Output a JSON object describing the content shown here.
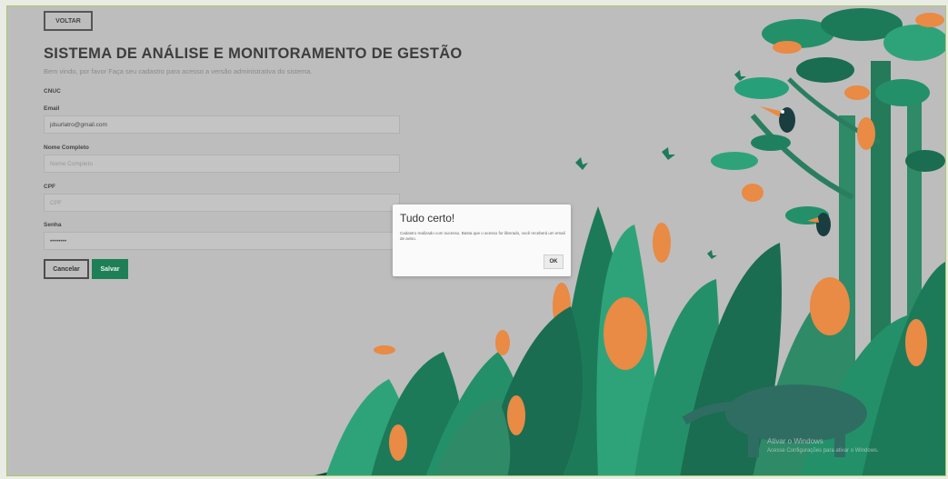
{
  "page": {
    "back_button": "VOLTAR",
    "title": "SISTEMA DE ANÁLISE E MONITORAMENTO DE GESTÃO",
    "subtitle": "Bem vindo, por favor Faça seu cadastro para acesso a versão administrativa do sistema."
  },
  "form": {
    "cnuc_label": "CNUC",
    "email_label": "Email",
    "email_value": "jdsurlatro@gmail.com",
    "name_label": "Nome Completo",
    "name_placeholder": "Nome Completo",
    "cpf_label": "CPF",
    "cpf_placeholder": "CPF",
    "password_label": "Senha",
    "password_value": "••••••••",
    "cancel_label": "Cancelar",
    "save_label": "Salvar"
  },
  "dialog": {
    "title": "Tudo certo!",
    "message": "Cadastro realizado com sucesso. Basta que o acesso for liberado, você receberá um email de aviso.",
    "ok_label": "OK"
  },
  "watermark": {
    "line1": "Ativar o Windows",
    "line2": "Acesse Configurações para ativar o Windows."
  },
  "colors": {
    "background": "#bdbdbd",
    "accent": "#1e7f57",
    "frame_border": "#aac86b"
  },
  "icons": [
    "jungle-illustration",
    "toucan-icon",
    "butterfly-icon",
    "anteater-icon"
  ]
}
